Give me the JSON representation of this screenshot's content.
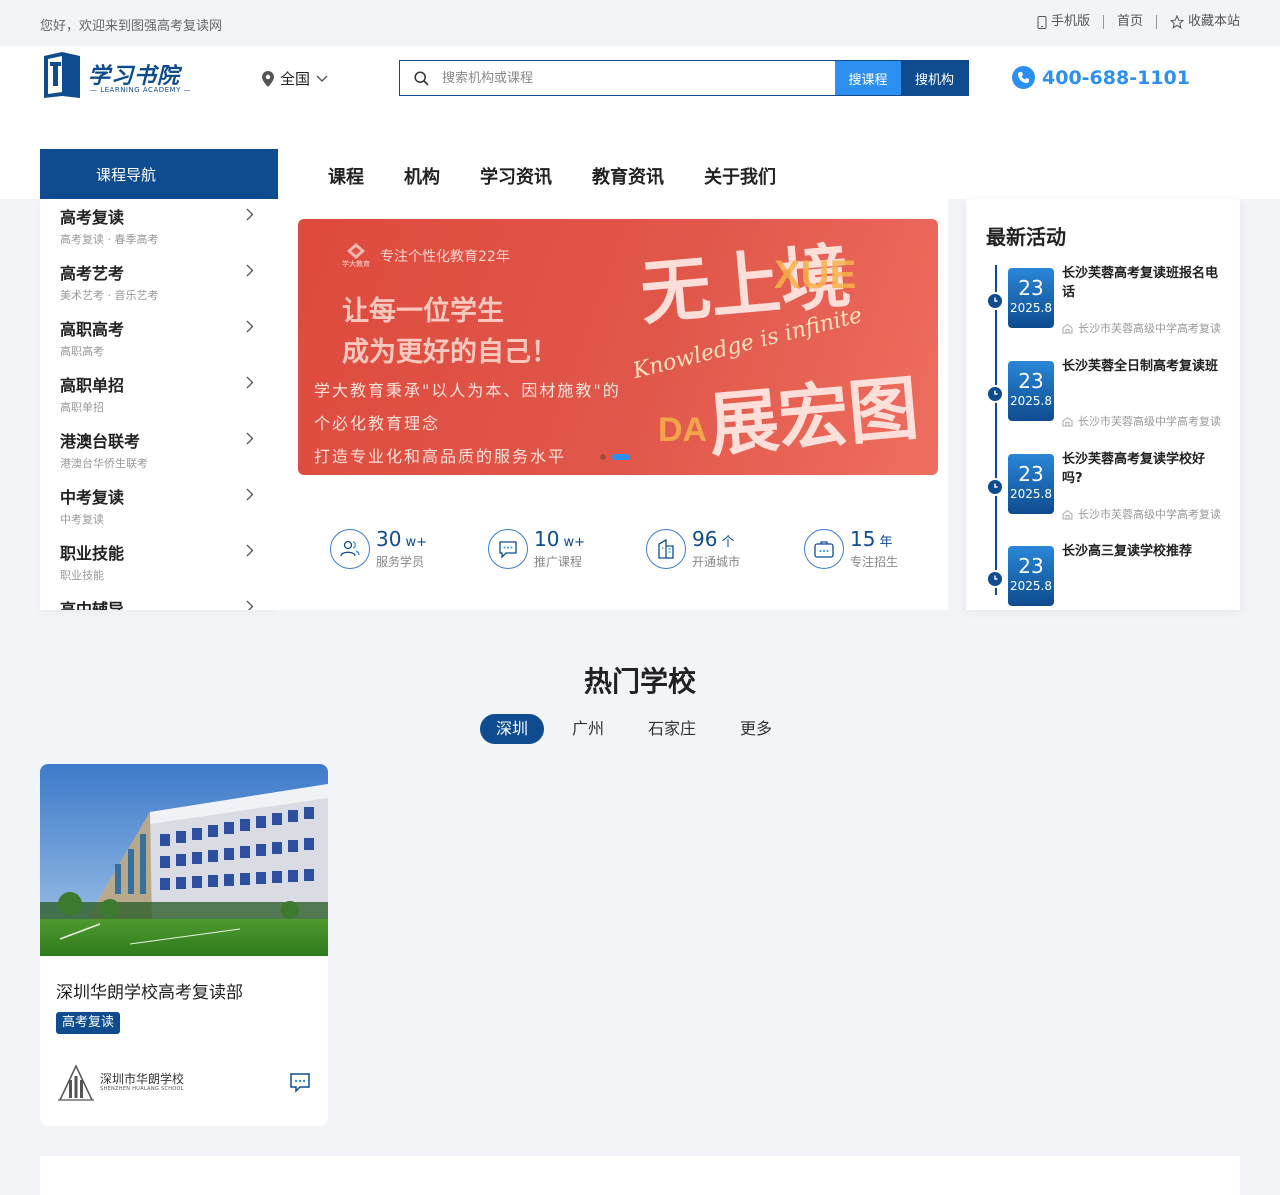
{
  "topbar": {
    "welcome": "您好，欢迎来到图强高考复读网",
    "mobile": "手机版",
    "home": "首页",
    "favorite": "收藏本站"
  },
  "header": {
    "logo_name": "学习书院",
    "logo_sub": "— LEARNING ACADEMY —",
    "region": "全国",
    "search_placeholder": "搜索机构或课程",
    "search_course": "搜课程",
    "search_org": "搜机构",
    "phone": "400-688-1101"
  },
  "nav": {
    "title": "课程导航",
    "items": [
      "课程",
      "机构",
      "学习资讯",
      "教育资讯",
      "关于我们"
    ]
  },
  "categories": [
    {
      "title": "高考复读",
      "sub": "高考复读 · 春季高考"
    },
    {
      "title": "高考艺考",
      "sub": "美术艺考 · 音乐艺考"
    },
    {
      "title": "高职高考",
      "sub": "高职高考"
    },
    {
      "title": "高职单招",
      "sub": "高职单招"
    },
    {
      "title": "港澳台联考",
      "sub": "港澳台华侨生联考"
    },
    {
      "title": "中考复读",
      "sub": "中考复读"
    },
    {
      "title": "职业技能",
      "sub": "职业技能"
    },
    {
      "title": "高中辅导",
      "sub": ""
    }
  ],
  "banner": {
    "brand": "专注个性化教育22年",
    "brand_logo": "学大教育",
    "headline1": "让每一位学生",
    "headline2": "成为更好的自己！",
    "line1": "学大教育秉承\"以人为本、因材施教\"的",
    "line2": "个必化教育理念",
    "line3": "打造专业化和高品质的服务水平",
    "big1": "无上境",
    "big2": "展宏图",
    "xue": "XUE",
    "da": "DA",
    "script": "Knowledge is infinite"
  },
  "stats": [
    {
      "num": "30",
      "unit": "w+",
      "label": "服务学员",
      "icon": "users-icon"
    },
    {
      "num": "10",
      "unit": "w+",
      "label": "推广课程",
      "icon": "chat-icon"
    },
    {
      "num": "96",
      "unit": "个",
      "label": "开通城市",
      "icon": "building-icon"
    },
    {
      "num": "15",
      "unit": "年",
      "label": "专注招生",
      "icon": "briefcase-icon"
    }
  ],
  "activities": {
    "title": "最新活动",
    "items": [
      {
        "day": "23",
        "ym": "2025.8",
        "title": "长沙芙蓉高考复读班报名电话",
        "source": "长沙市芙蓉高级中学高考复读"
      },
      {
        "day": "23",
        "ym": "2025.8",
        "title": "长沙芙蓉全日制高考复读班",
        "source": "长沙市芙蓉高级中学高考复读"
      },
      {
        "day": "23",
        "ym": "2025.8",
        "title": "长沙芙蓉高考复读学校好吗?",
        "source": "长沙市芙蓉高级中学高考复读"
      },
      {
        "day": "23",
        "ym": "2025.8",
        "title": "长沙高三复读学校推荐",
        "source": ""
      }
    ]
  },
  "hot": {
    "title": "热门学校",
    "tabs": [
      "深圳",
      "广州",
      "石家庄",
      "更多"
    ],
    "school": {
      "name": "深圳华朗学校高考复读部",
      "tag": "高考复读",
      "logo_cn": "深圳市华朗学校",
      "logo_en": "SHENZHEN HUALANG SCHOOL"
    }
  },
  "colors": {
    "primary": "#0e4c8f",
    "accent": "#2d8ff0",
    "banner": "#de4a3d"
  }
}
